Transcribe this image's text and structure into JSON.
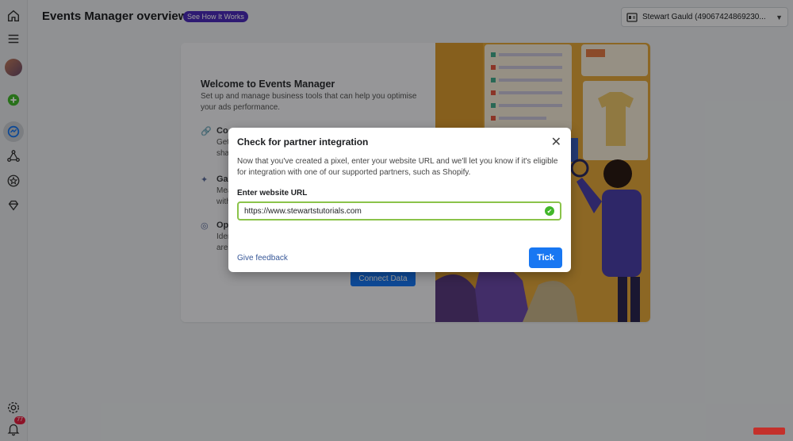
{
  "header": {
    "title": "Events Manager overview",
    "see_how_label": "See How It Works",
    "account_label": "Stewart Gauld (49067424869230..."
  },
  "rail": {
    "notification_count": "77"
  },
  "welcome_card": {
    "title": "Welcome to Events Manager",
    "subtitle": "Set up and manage business tools that can help you optimise your ads performance.",
    "features": [
      {
        "title": "Co",
        "desc_line1": "Get",
        "desc_line2": "sha"
      },
      {
        "title": "Ga",
        "desc_line1": "Mea",
        "desc_line2": "with"
      },
      {
        "title": "Opt",
        "desc_line1": "Iden",
        "desc_line2": "are"
      }
    ],
    "connect_label": "Connect Data"
  },
  "dialog": {
    "title": "Check for partner integration",
    "description": "Now that you've created a pixel, enter your website URL and we'll let you know if it's eligible for integration with one of our supported partners, such as Shopify.",
    "url_label": "Enter website URL",
    "url_value": "https://www.stewartstutorials.com",
    "feedback_label": "Give feedback",
    "tick_label": "Tick"
  },
  "colors": {
    "primary_blue": "#1877f2",
    "badge_purple": "#4b2bb8",
    "valid_green": "#42b72a",
    "art_yellow": "#e7b23a"
  }
}
